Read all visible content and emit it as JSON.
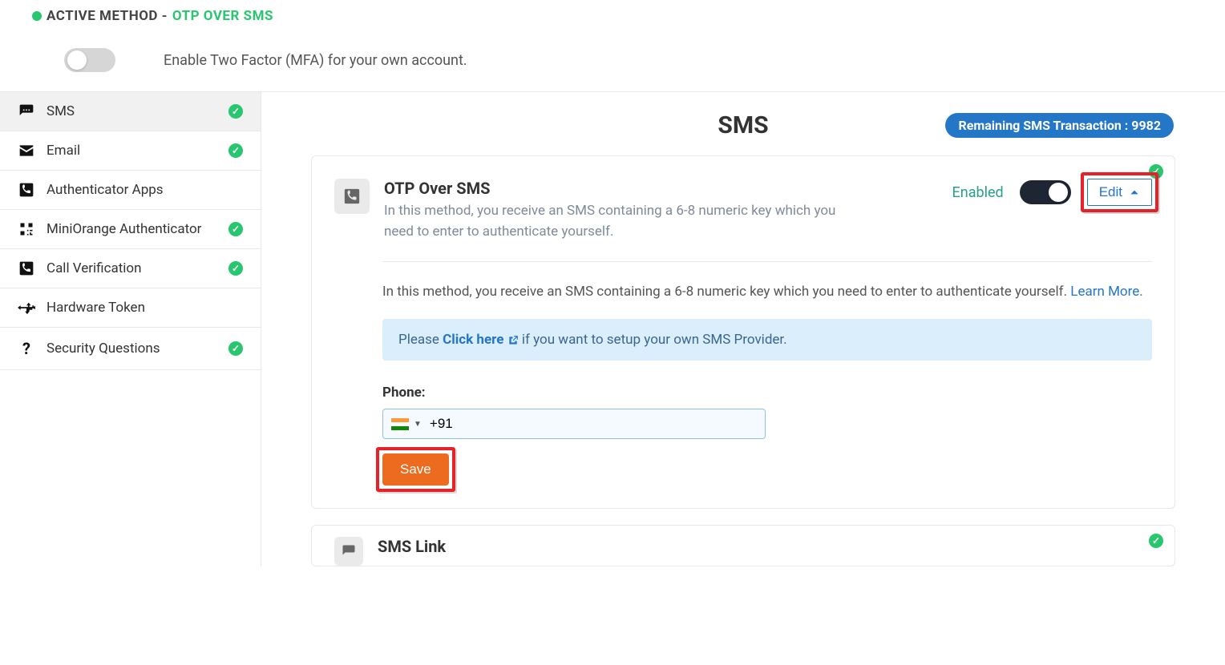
{
  "header": {
    "active_method_prefix": "ACTIVE METHOD - ",
    "active_method_value": "OTP OVER SMS",
    "mfa_toggle_text": "Enable Two Factor (MFA) for your own account."
  },
  "sidebar": {
    "items": [
      {
        "label": "SMS",
        "checked": true
      },
      {
        "label": "Email",
        "checked": true
      },
      {
        "label": "Authenticator Apps",
        "checked": false
      },
      {
        "label": "MiniOrange Authenticator",
        "checked": true
      },
      {
        "label": "Call Verification",
        "checked": true
      },
      {
        "label": "Hardware Token",
        "checked": false
      },
      {
        "label": "Security Questions",
        "checked": true
      }
    ]
  },
  "main": {
    "title": "SMS",
    "remaining_badge": "Remaining SMS Transaction : 9982",
    "otp_card": {
      "title": "OTP Over SMS",
      "desc": "In this method, you receive an SMS containing a 6-8 numeric key which you need to enter to authenticate yourself.",
      "enabled_label": "Enabled",
      "edit_label": "Edit",
      "body_text": "In this method, you receive an SMS containing a 6-8 numeric key which you need to enter to authenticate yourself. ",
      "learn_more": "Learn More.",
      "banner_prefix": "Please ",
      "banner_link": "Click here",
      "banner_suffix": " if you want to setup your own SMS Provider.",
      "phone_label": "Phone:",
      "phone_value": "+91",
      "save_label": "Save"
    },
    "peek_card_title": "SMS Link"
  }
}
